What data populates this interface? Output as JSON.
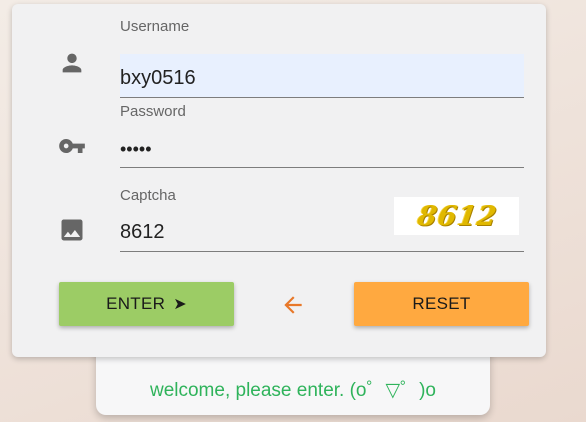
{
  "form": {
    "username": {
      "label": "Username",
      "value": "bxy0516",
      "icon": "person-icon"
    },
    "password": {
      "label": "Password",
      "value": "•••••",
      "icon": "key-icon"
    },
    "captcha": {
      "label": "Captcha",
      "value": "8612",
      "image_text": "8612",
      "icon": "image-icon"
    }
  },
  "buttons": {
    "enter_label": "ENTER",
    "enter_glyph": "➤",
    "reset_label": "RESET",
    "back_icon": "arrow-left-icon"
  },
  "message": {
    "text": "welcome, please enter. (o゜▽゜)o"
  },
  "colors": {
    "enter_bg": "#9ccc65",
    "reset_bg": "#ffa940",
    "back_arrow": "#e8782a",
    "welcome_text": "#2fb35b",
    "icon_gray": "#666666",
    "autofill_bg": "#e8f0fe"
  }
}
